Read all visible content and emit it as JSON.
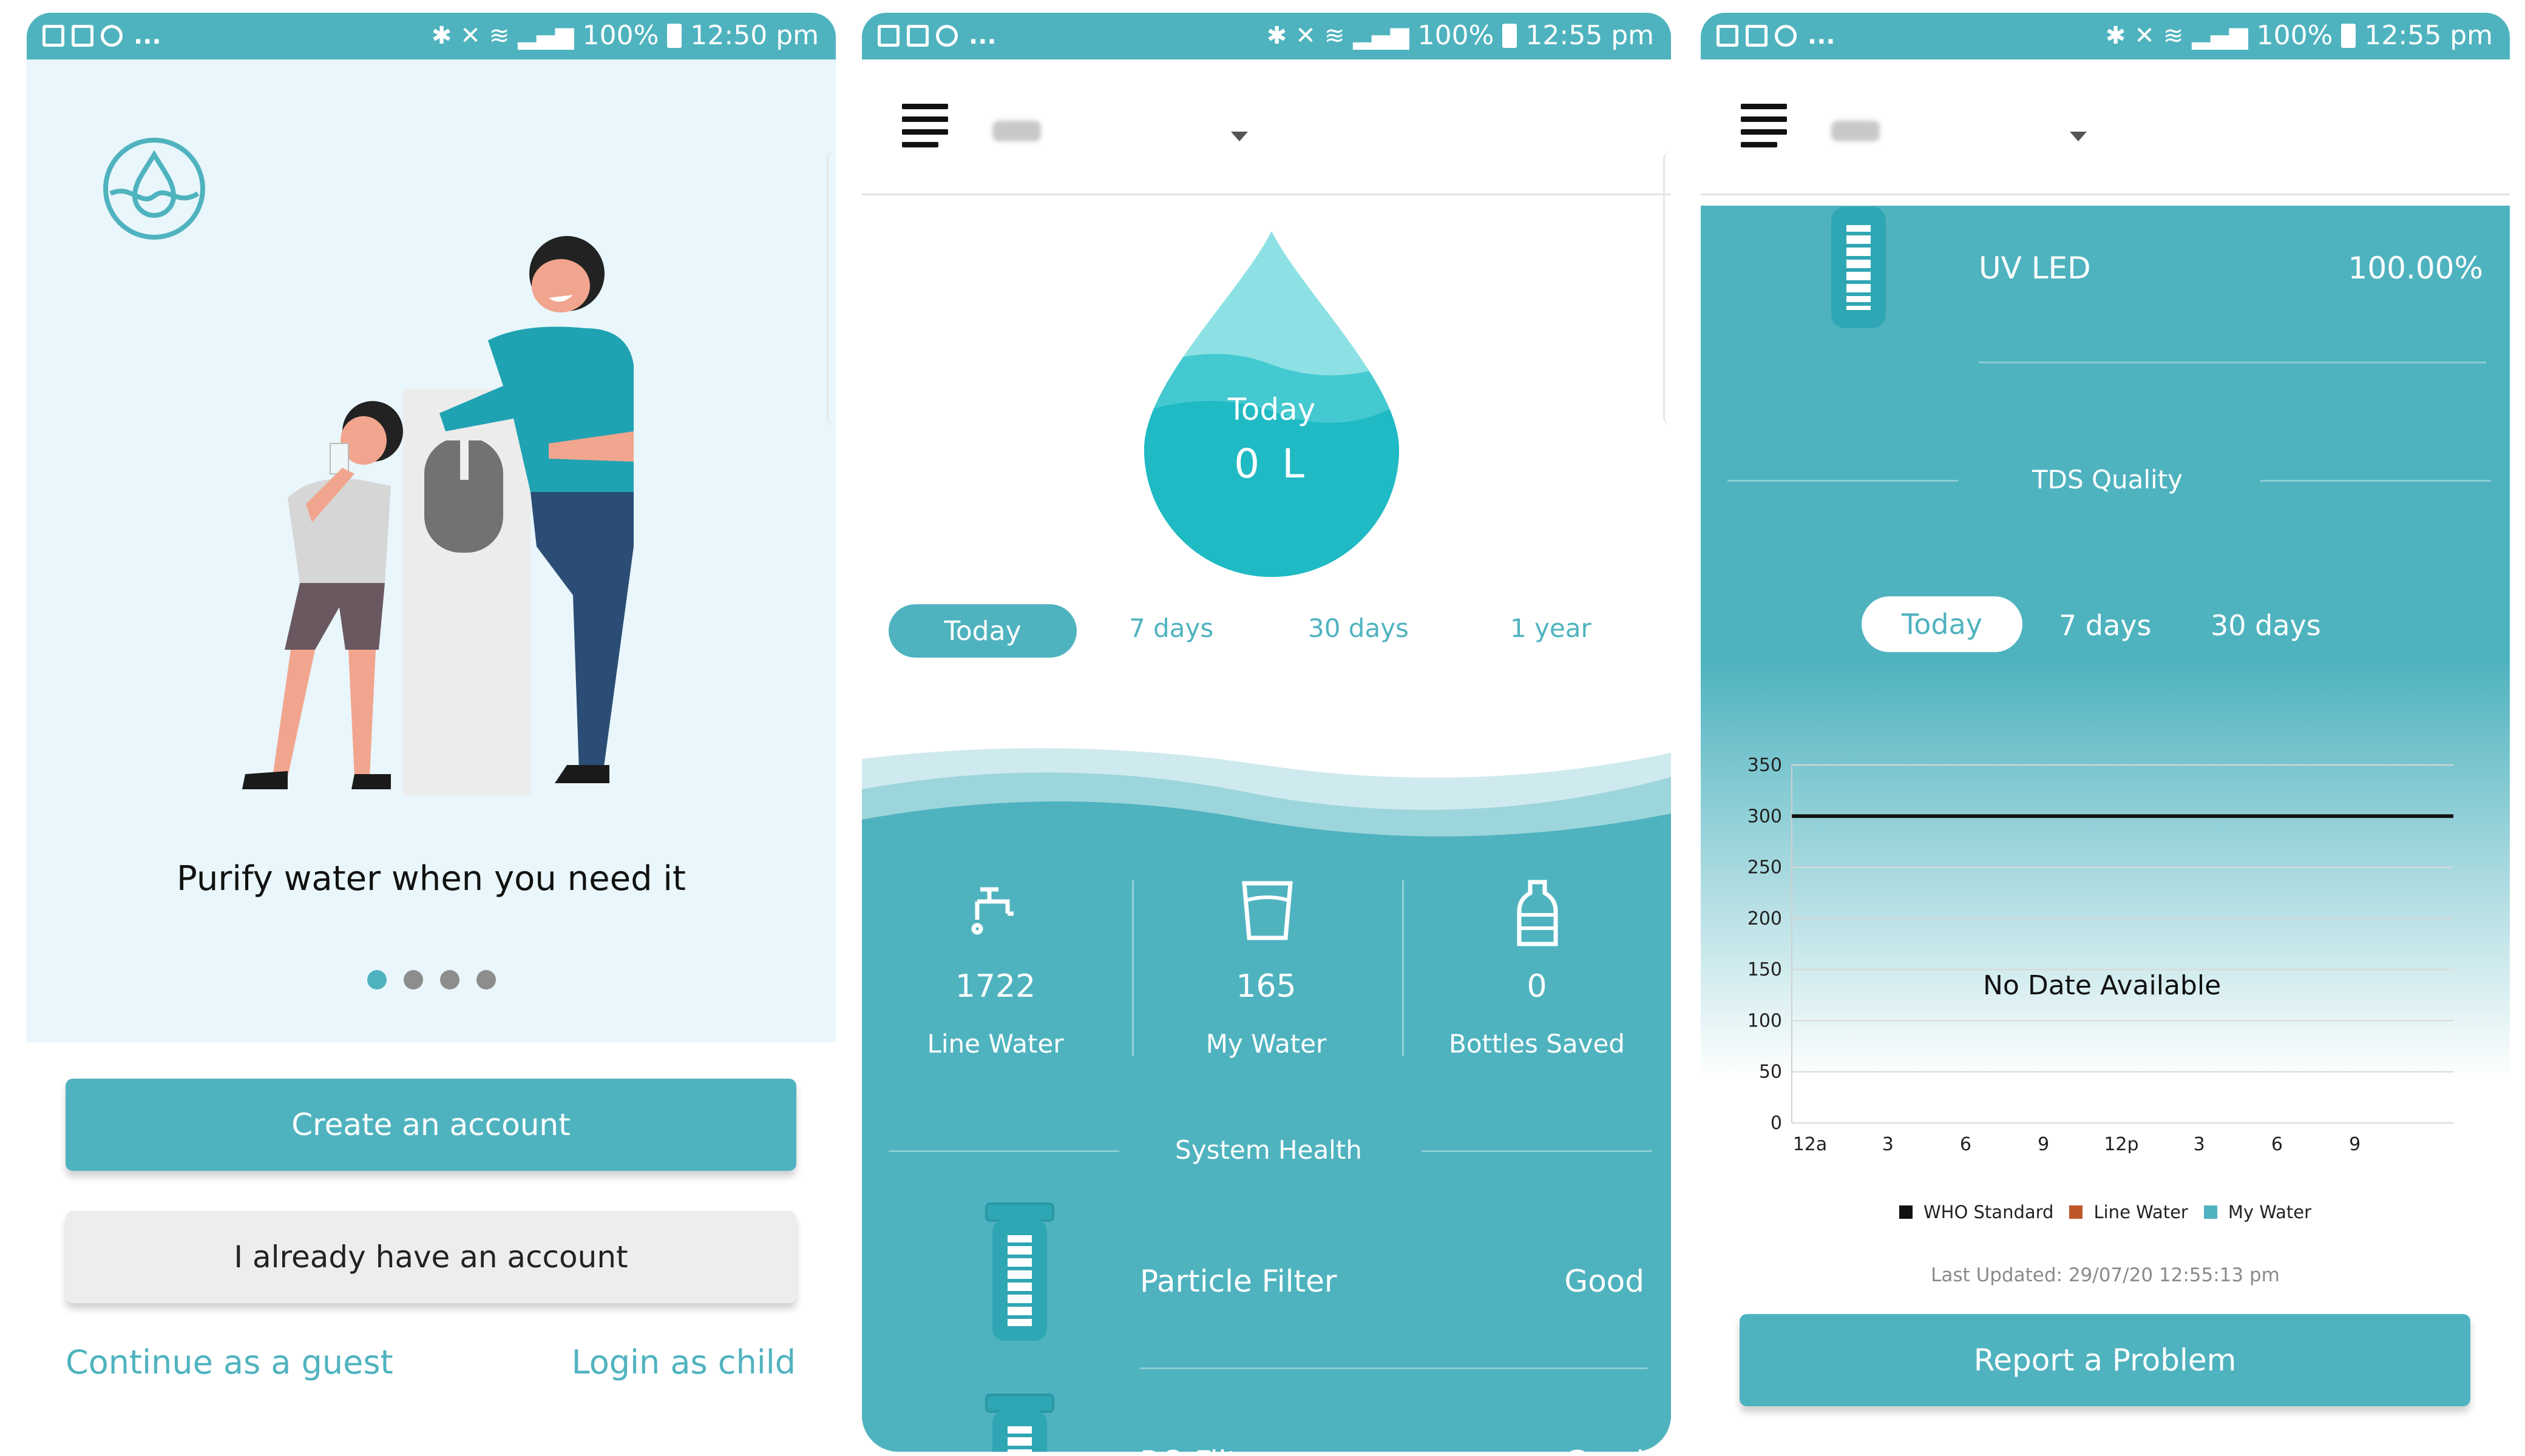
{
  "colors": {
    "teal": "#4fb3bf",
    "light_bg": "#e9f6fb",
    "dark_teal": "#1fb3bd"
  },
  "status": {
    "left_dots": "...",
    "battery": "100%",
    "screen1_time": "12:50 pm",
    "screen2_time": "12:55 pm",
    "screen3_time": "12:55 pm"
  },
  "screen1": {
    "tagline": "Purify water when you need it",
    "pager_dots": 4,
    "create_account": "Create an account",
    "have_account": "I already have an account",
    "guest": "Continue as a guest",
    "child_login": "Login as child"
  },
  "screen2": {
    "drop_label": "Today",
    "drop_value": "0 L",
    "tabs": [
      {
        "label": "Today"
      },
      {
        "label": "7 days"
      },
      {
        "label": "30 days"
      },
      {
        "label": "1 year"
      }
    ],
    "stats": [
      {
        "value": "1722",
        "label": "Line Water",
        "icon": "tap-icon"
      },
      {
        "value": "165",
        "label": "My Water",
        "icon": "glass-icon"
      },
      {
        "value": "0",
        "label": "Bottles Saved",
        "icon": "bottle-icon"
      }
    ],
    "system_health": "System Health",
    "filters": [
      {
        "name": "Particle Filter",
        "status": "Good"
      },
      {
        "name": "RO Filter",
        "status": "Good"
      }
    ]
  },
  "screen3": {
    "uv_label": "UV LED",
    "uv_value": "100.00%",
    "tds_heading": "TDS Quality",
    "tabs": [
      {
        "label": "Today"
      },
      {
        "label": "7 days"
      },
      {
        "label": "30 days"
      }
    ],
    "no_data": "No Date Available",
    "legend": [
      {
        "label": "WHO Standard",
        "color": "#111111"
      },
      {
        "label": "Line Water",
        "color": "#c0572a"
      },
      {
        "label": "My Water",
        "color": "#4fb3bf"
      }
    ],
    "last_updated": "Last Updated: 29/07/20 12:55:13 pm",
    "report": "Report a Problem"
  },
  "chart_data": {
    "type": "line",
    "title": "",
    "categories": [
      "12a",
      "3",
      "6",
      "9",
      "12p",
      "3",
      "6",
      "9"
    ],
    "y_ticks": [
      "0",
      "50",
      "100",
      "150",
      "200",
      "250",
      "300",
      "350"
    ],
    "ylim": [
      0,
      350
    ],
    "grid": true,
    "series": [
      {
        "name": "WHO Standard",
        "values": [
          300,
          300,
          300,
          300,
          300,
          300,
          300,
          300
        ]
      },
      {
        "name": "Line Water",
        "values": []
      },
      {
        "name": "My Water",
        "values": []
      }
    ],
    "legend_position": "bottom"
  }
}
